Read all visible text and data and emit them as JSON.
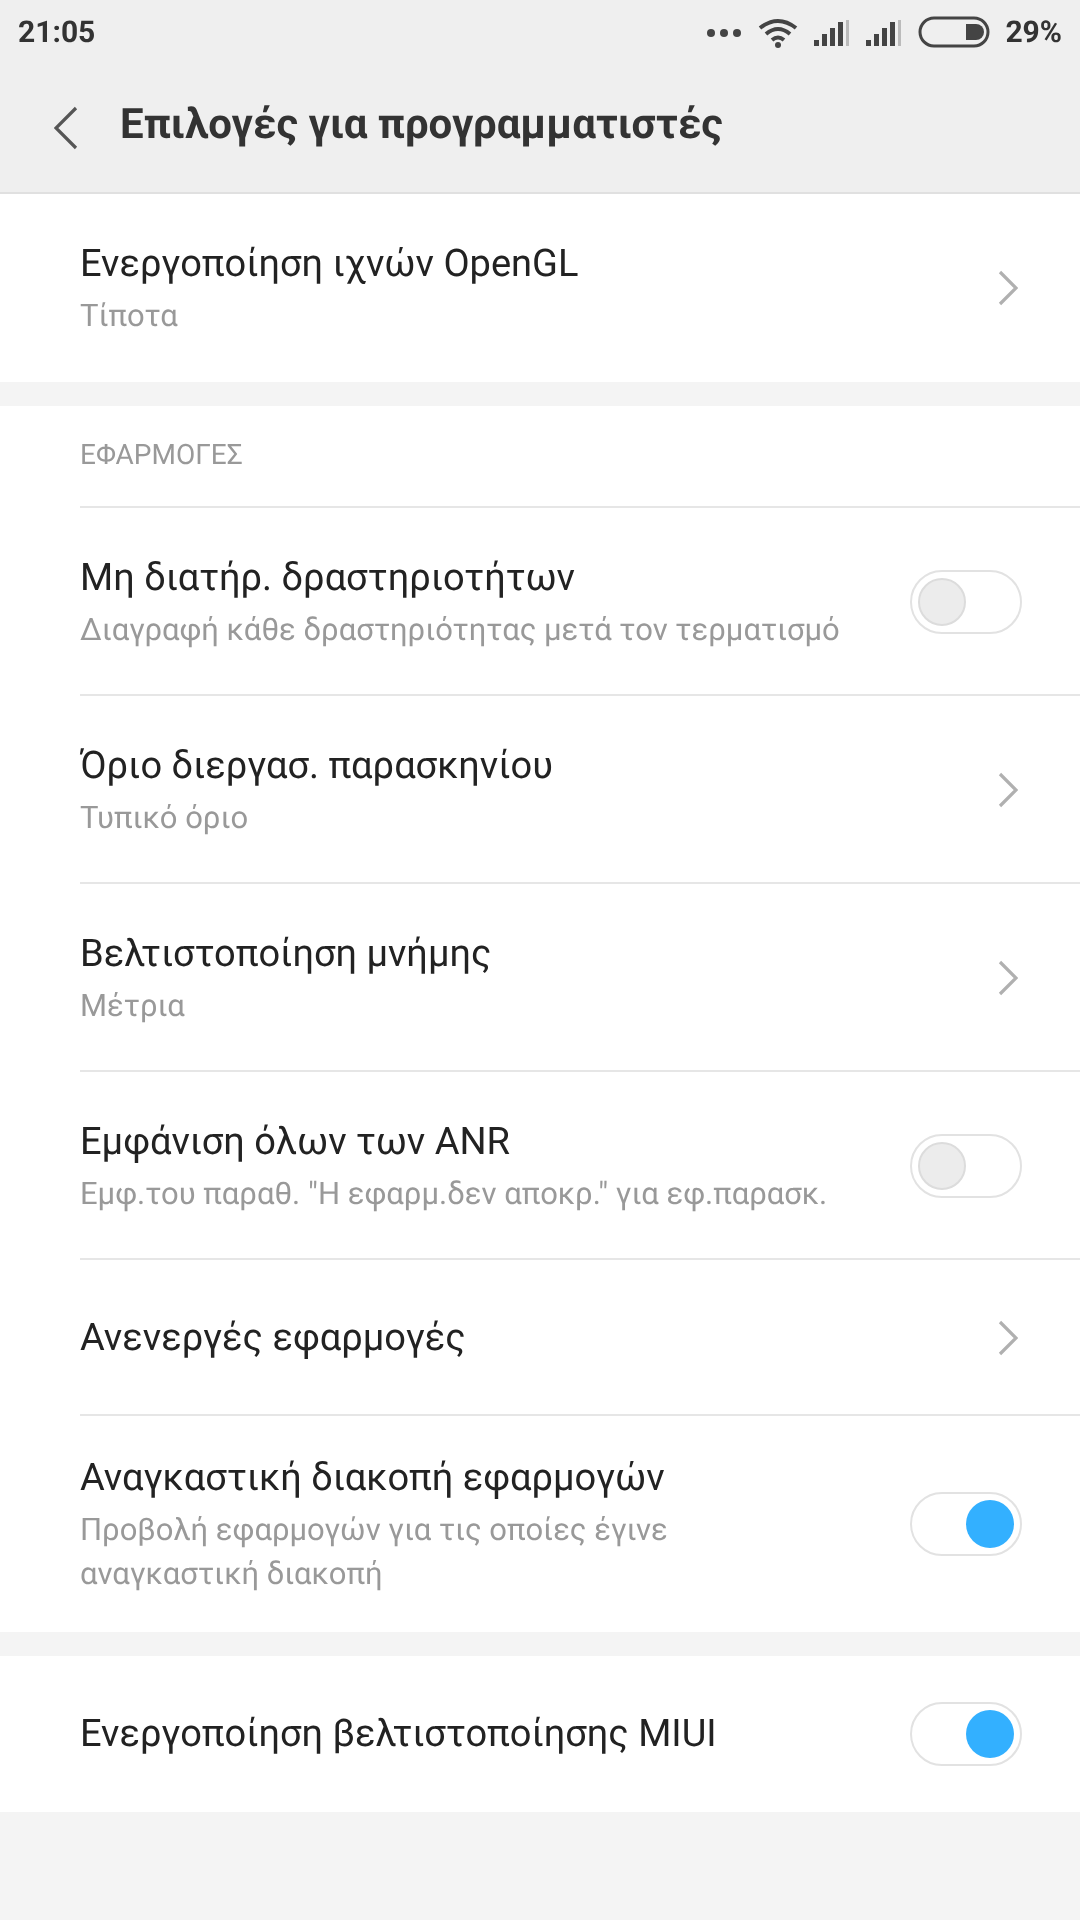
{
  "status_bar": {
    "time": "21:05",
    "battery": "29%"
  },
  "header": {
    "title": "Επιλογές για προγραμματιστές"
  },
  "sections": [
    {
      "items": [
        {
          "kind": "nav",
          "title": "Ενεργοποίηση ιχνών OpenGL",
          "subtitle": "Τίποτα"
        }
      ]
    },
    {
      "header": "ΕΦΑΡΜΟΓΕΣ",
      "items": [
        {
          "kind": "toggle",
          "title": "Μη διατήρ. δραστηριοτήτων",
          "subtitle": "Διαγραφή κάθε δραστηριότητας μετά τον τερματισμό",
          "on": false
        },
        {
          "kind": "nav",
          "title": "Όριο διεργασ. παρασκηνίου",
          "subtitle": "Τυπικό όριο"
        },
        {
          "kind": "nav",
          "title": "Βελτιστοποίηση μνήμης",
          "subtitle": "Μέτρια"
        },
        {
          "kind": "toggle",
          "title": "Εμφάνιση όλων των ANR",
          "subtitle": "Εμφ.του παραθ. \"Η εφαρμ.δεν αποκρ.\" για εφ.παρασκ.",
          "on": false
        },
        {
          "kind": "nav",
          "title": "Ανενεργές εφαρμογές"
        },
        {
          "kind": "toggle",
          "title": "Αναγκαστική διακοπή εφαρμογών",
          "subtitle": "Προβολή εφαρμογών για τις οποίες έγινε αναγκαστική διακοπή",
          "on": true
        }
      ]
    },
    {
      "items": [
        {
          "kind": "toggle",
          "title": "Ενεργοποίηση βελτιστοποίησης MIUI",
          "on": true
        }
      ]
    }
  ]
}
